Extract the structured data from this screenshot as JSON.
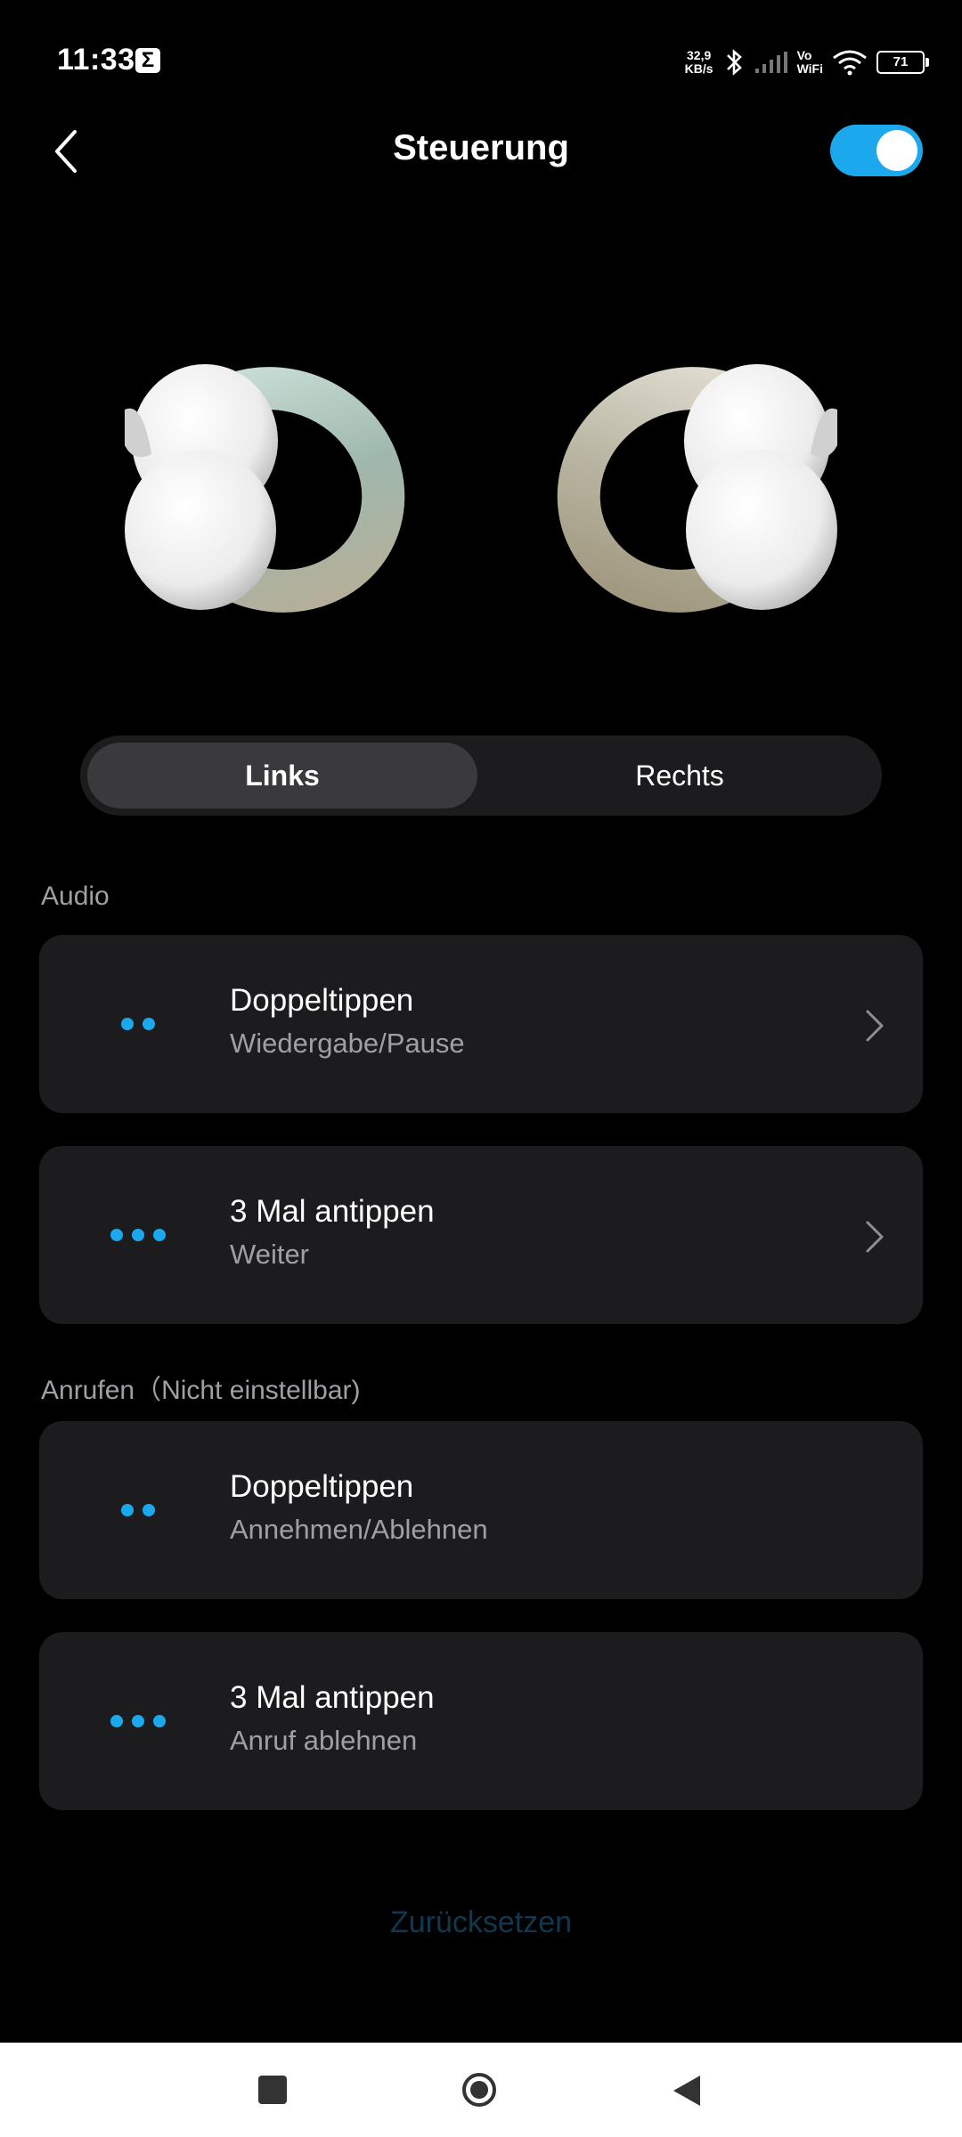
{
  "status_bar": {
    "time": "11:33",
    "notification_icon": "sigma",
    "net_speed_value": "32,9",
    "net_speed_unit": "KB/s",
    "vowifi_top": "Vo",
    "vowifi_bottom": "WiFi",
    "battery": "71"
  },
  "header": {
    "title": "Steuerung",
    "toggle_on": true,
    "accent_color": "#1ca8ec"
  },
  "tabs": {
    "left": "Links",
    "right": "Rechts",
    "selected": "Links"
  },
  "audio_section": {
    "label": "Audio",
    "items": [
      {
        "gesture": "Doppeltippen",
        "action": "Wiedergabe/Pause",
        "dots": 2
      },
      {
        "gesture": "3 Mal antippen",
        "action": "Weiter",
        "dots": 3
      }
    ]
  },
  "call_section": {
    "label": "Anrufen（Nicht einstellbar)",
    "items": [
      {
        "gesture": "Doppeltippen",
        "action": "Annehmen/Ablehnen",
        "dots": 2
      },
      {
        "gesture": "3 Mal antippen",
        "action": "Anruf ablehnen",
        "dots": 3
      }
    ]
  },
  "reset_label": "Zurücksetzen"
}
